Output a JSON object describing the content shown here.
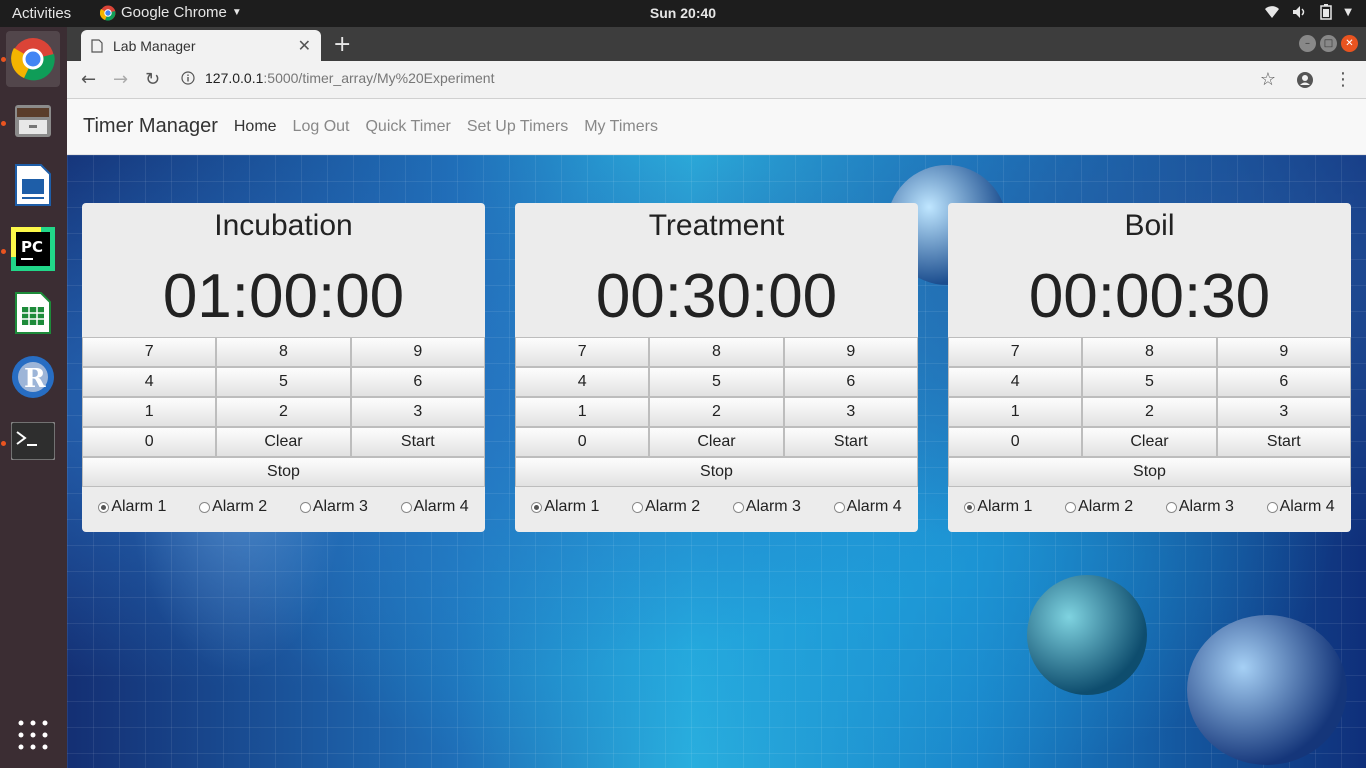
{
  "system": {
    "activities": "Activities",
    "app_menu": "Google Chrome",
    "clock": "Sun 20:40"
  },
  "browser": {
    "tab_title": "Lab Manager",
    "url_host": "127.0.0.1",
    "url_path": ":5000/timer_array/My%20Experiment"
  },
  "navbar": {
    "brand": "Timer Manager",
    "links": [
      "Home",
      "Log Out",
      "Quick Timer",
      "Set Up Timers",
      "My Timers"
    ],
    "active": "Home"
  },
  "keypad": {
    "rows": [
      [
        "7",
        "8",
        "9"
      ],
      [
        "4",
        "5",
        "6"
      ],
      [
        "1",
        "2",
        "3"
      ],
      [
        "0",
        "Clear",
        "Start"
      ]
    ],
    "stop": "Stop"
  },
  "alarms": [
    "Alarm 1",
    "Alarm 2",
    "Alarm 3",
    "Alarm 4"
  ],
  "timers": [
    {
      "name": "Incubation",
      "time": "01:00:00",
      "selected_alarm": "Alarm 1"
    },
    {
      "name": "Treatment",
      "time": "00:30:00",
      "selected_alarm": "Alarm 1"
    },
    {
      "name": "Boil",
      "time": "00:00:30",
      "selected_alarm": "Alarm 1"
    }
  ],
  "colors": {
    "accent": "#e95420",
    "panel": "#ececec",
    "navbar": "#f8f8f8"
  }
}
